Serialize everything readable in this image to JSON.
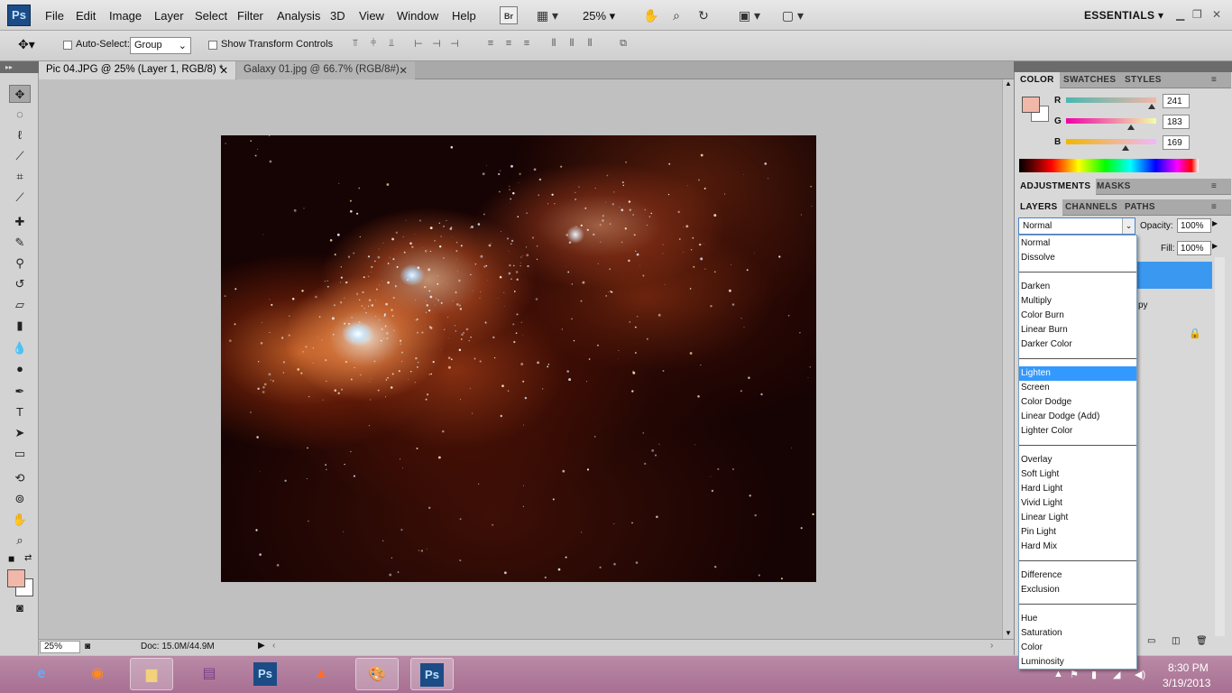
{
  "menubar": {
    "logo": "Ps",
    "items": [
      "File",
      "Edit",
      "Image",
      "Layer",
      "Select",
      "Filter",
      "Analysis",
      "3D",
      "View",
      "Window",
      "Help"
    ],
    "bridge_label": "Br",
    "zoom": "25%",
    "workspace": "ESSENTIALS"
  },
  "options": {
    "auto_select_label": "Auto-Select:",
    "auto_select_value": "Group",
    "transform_label": "Show Transform Controls"
  },
  "tabs": [
    {
      "label": "Pic 04.JPG @ 25% (Layer 1, RGB/8) *"
    },
    {
      "label": "Galaxy 01.jpg @ 66.7% (RGB/8#)"
    }
  ],
  "status": {
    "zoom": "25%",
    "doc": "Doc: 15.0M/44.9M"
  },
  "color_panel": {
    "tabs": [
      "COLOR",
      "SWATCHES",
      "STYLES"
    ],
    "r_label": "R",
    "g_label": "G",
    "b_label": "B",
    "r": "241",
    "g": "183",
    "b": "169",
    "foreground": "#f1b7a9",
    "r_level": 0.945,
    "g_level": 0.718,
    "b_level": 0.663
  },
  "adjust_panel": {
    "tabs": [
      "ADJUSTMENTS",
      "MASKS"
    ]
  },
  "layers_panel": {
    "tabs": [
      "LAYERS",
      "CHANNELS",
      "PATHS"
    ],
    "blend_mode": "Normal",
    "opacity_label": "Opacity:",
    "opacity": "100%",
    "fill_label": "Fill:",
    "fill": "100%",
    "layer2_partial": "py"
  },
  "blend_dropdown": {
    "groups": [
      [
        "Normal",
        "Dissolve"
      ],
      [
        "Darken",
        "Multiply",
        "Color Burn",
        "Linear Burn",
        "Darker Color"
      ],
      [
        "Lighten",
        "Screen",
        "Color Dodge",
        "Linear Dodge (Add)",
        "Lighter Color"
      ],
      [
        "Overlay",
        "Soft Light",
        "Hard Light",
        "Vivid Light",
        "Linear Light",
        "Pin Light",
        "Hard Mix"
      ],
      [
        "Difference",
        "Exclusion"
      ],
      [
        "Hue",
        "Saturation",
        "Color",
        "Luminosity"
      ]
    ],
    "highlighted": "Lighten"
  },
  "taskbar": {
    "time": "8:30 PM",
    "date": "3/19/2013",
    "ps_label": "Ps"
  }
}
